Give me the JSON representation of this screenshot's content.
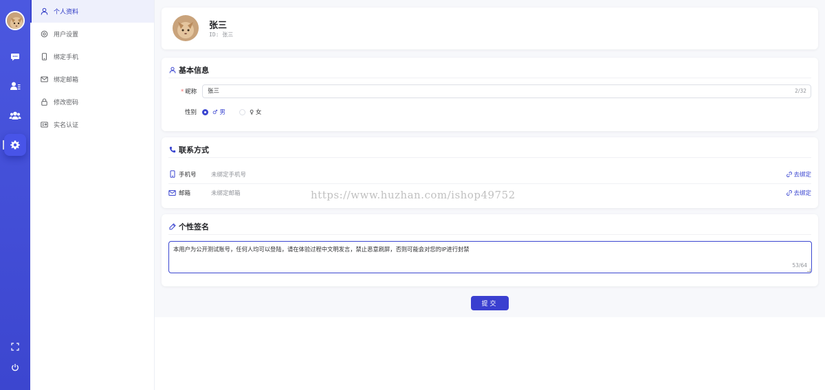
{
  "rail": {
    "icons": [
      "avatar",
      "chat-icon",
      "user-list-icon",
      "group-icon",
      "gear-icon"
    ],
    "bottom_icons": [
      "fullscreen-icon",
      "power-icon"
    ]
  },
  "submenu": {
    "items": [
      {
        "label": "个人资料",
        "icon": "user-icon",
        "active": true
      },
      {
        "label": "用户设置",
        "icon": "settings-icon",
        "active": false
      },
      {
        "label": "绑定手机",
        "icon": "phone-icon",
        "active": false
      },
      {
        "label": "绑定邮箱",
        "icon": "mail-icon",
        "active": false
      },
      {
        "label": "修改密码",
        "icon": "lock-icon",
        "active": false
      },
      {
        "label": "实名认证",
        "icon": "id-card-icon",
        "active": false
      }
    ]
  },
  "profile": {
    "name": "张三",
    "id_text": "ID: 张三"
  },
  "basic": {
    "title": "基本信息",
    "nickname_label": "昵称",
    "nickname_value": "张三",
    "nickname_count": "2/32",
    "gender_label": "性别",
    "gender_male": "♂ 男",
    "gender_female": "♀ 女",
    "gender_selected": "male"
  },
  "contact": {
    "title": "联系方式",
    "phone_label": "手机号",
    "phone_value": "未绑定手机号",
    "phone_action": "去绑定",
    "email_label": "邮箱",
    "email_value": "未绑定邮箱",
    "email_action": "去绑定"
  },
  "signature": {
    "title": "个性签名",
    "value": "本用户为公开测试账号，任何人均可以登陆，请在体验过程中文明发言，禁止恶意刷屏，否则可能会对您的IP进行封禁",
    "count": "53/64"
  },
  "submit_label": "提交",
  "watermark": "https://www.huzhan.com/ishop49752",
  "colors": {
    "accent": "#3a45d0",
    "rail": "#4451dc",
    "required": "#f56c6c"
  }
}
